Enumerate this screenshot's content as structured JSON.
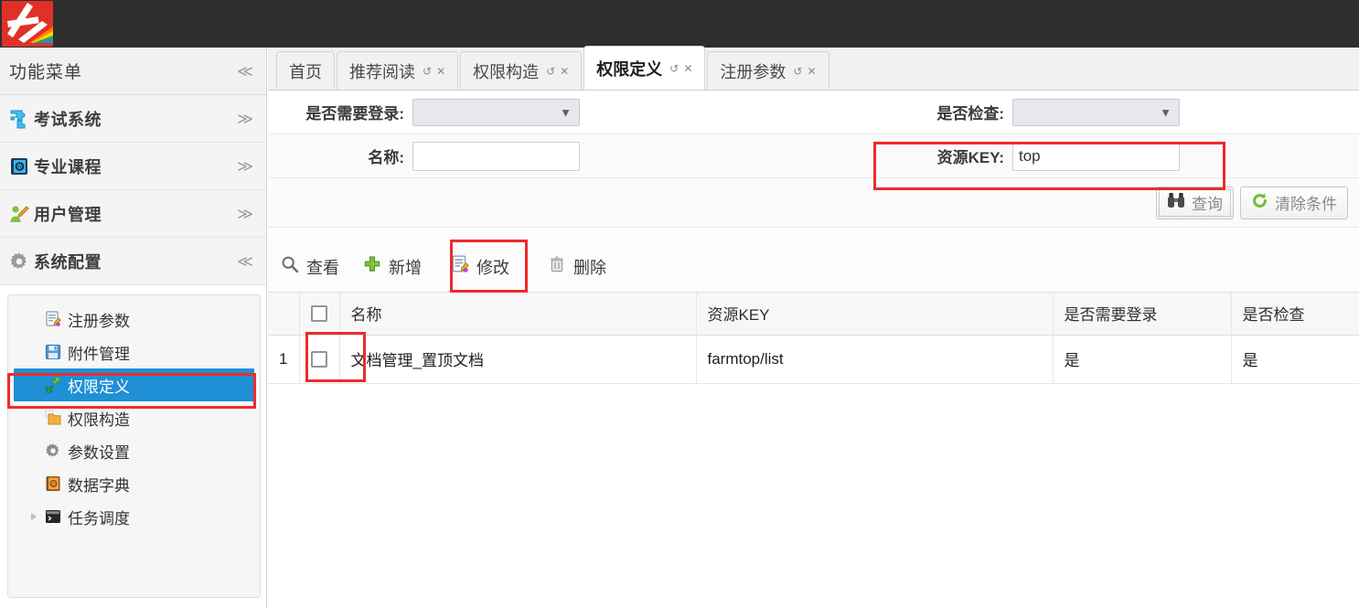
{
  "app": {
    "logo_icon": "app-logo-icon",
    "logo_colors": {
      "bg": "#e03127",
      "mark": "#ffffff",
      "accent1": "#ff7f00",
      "accent2": "#ffd400",
      "accent3": "#23a455",
      "accent4": "#1f8fd6",
      "accent5": "#b133c0"
    }
  },
  "sidebar": {
    "header": {
      "title": "功能菜单",
      "collapse_icon": "chevron-double-left-icon"
    },
    "groups": [
      {
        "label": "考试系统",
        "icon": "puzzle-icon",
        "state_icon": "chevron-double-down-icon",
        "expanded": false
      },
      {
        "label": "专业课程",
        "icon": "book-icon",
        "state_icon": "chevron-double-down-icon",
        "expanded": false
      },
      {
        "label": "用户管理",
        "icon": "user-edit-icon",
        "state_icon": "chevron-double-down-icon",
        "expanded": false
      },
      {
        "label": "系统配置",
        "icon": "gear-icon",
        "state_icon": "chevron-double-up-icon",
        "expanded": true
      }
    ],
    "submenu": [
      {
        "label": "注册参数",
        "icon": "form-edit-icon",
        "selected": false,
        "has_expander": false
      },
      {
        "label": "附件管理",
        "icon": "floppy-save-icon",
        "selected": false,
        "has_expander": false
      },
      {
        "label": "权限定义",
        "icon": "green-arrows-icon",
        "selected": true,
        "has_expander": false
      },
      {
        "label": "权限构造",
        "icon": "folder-dashed-icon",
        "selected": false,
        "has_expander": false
      },
      {
        "label": "参数设置",
        "icon": "gear-icon",
        "selected": false,
        "has_expander": false
      },
      {
        "label": "数据字典",
        "icon": "orange-book-icon",
        "selected": false,
        "has_expander": false
      },
      {
        "label": "任务调度",
        "icon": "console-icon",
        "selected": false,
        "has_expander": true
      }
    ]
  },
  "tabs": [
    {
      "label": "首页",
      "active": false,
      "closable": false
    },
    {
      "label": "推荐阅读",
      "active": false,
      "closable": true,
      "refresh_icon": "refresh-icon",
      "close_icon": "close-icon"
    },
    {
      "label": "权限构造",
      "active": false,
      "closable": true,
      "refresh_icon": "refresh-icon",
      "close_icon": "close-icon"
    },
    {
      "label": "权限定义",
      "active": true,
      "closable": true,
      "refresh_icon": "refresh-icon",
      "close_icon": "close-icon"
    },
    {
      "label": "注册参数",
      "active": false,
      "closable": true,
      "refresh_icon": "refresh-icon",
      "close_icon": "close-icon"
    }
  ],
  "filter": {
    "need_login": {
      "label": "是否需要登录:",
      "value": "",
      "chevron_icon": "chevron-down-icon"
    },
    "check": {
      "label": "是否检查:",
      "value": "",
      "chevron_icon": "chevron-down-icon"
    },
    "name": {
      "label": "名称:",
      "value": "",
      "placeholder": ""
    },
    "resource_key": {
      "label": "资源KEY:",
      "value": "top",
      "placeholder": ""
    },
    "buttons": [
      {
        "label": "查询",
        "icon": "binoculars-icon",
        "focused": true
      },
      {
        "label": "清除条件",
        "icon": "refresh-green-icon",
        "focused": false
      }
    ]
  },
  "toolbar": {
    "actions": [
      {
        "label": "查看",
        "icon": "magnifier-icon"
      },
      {
        "label": "新增",
        "icon": "plus-green-icon"
      },
      {
        "label": "修改",
        "icon": "pencil-form-icon",
        "highlighted": true
      },
      {
        "label": "删除",
        "icon": "trash-icon"
      }
    ]
  },
  "table": {
    "columns": [
      "",
      "",
      "名称",
      "资源KEY",
      "是否需要登录",
      "是否检查"
    ],
    "header_checkbox_icon": "checkbox-icon",
    "rows": [
      {
        "index": "1",
        "checkbox_icon": "checkbox-icon",
        "name": "文档管理_置顶文档",
        "resource_key": "farmtop/list",
        "need_login": "是",
        "check": "是"
      }
    ]
  },
  "annotations": {
    "highlight_color": "#ee2b2b",
    "boxes": [
      {
        "name": "sidebar-permission-define-highlight"
      },
      {
        "name": "resource-key-field-highlight"
      },
      {
        "name": "modify-action-highlight"
      },
      {
        "name": "row-checkbox-highlight"
      }
    ]
  }
}
